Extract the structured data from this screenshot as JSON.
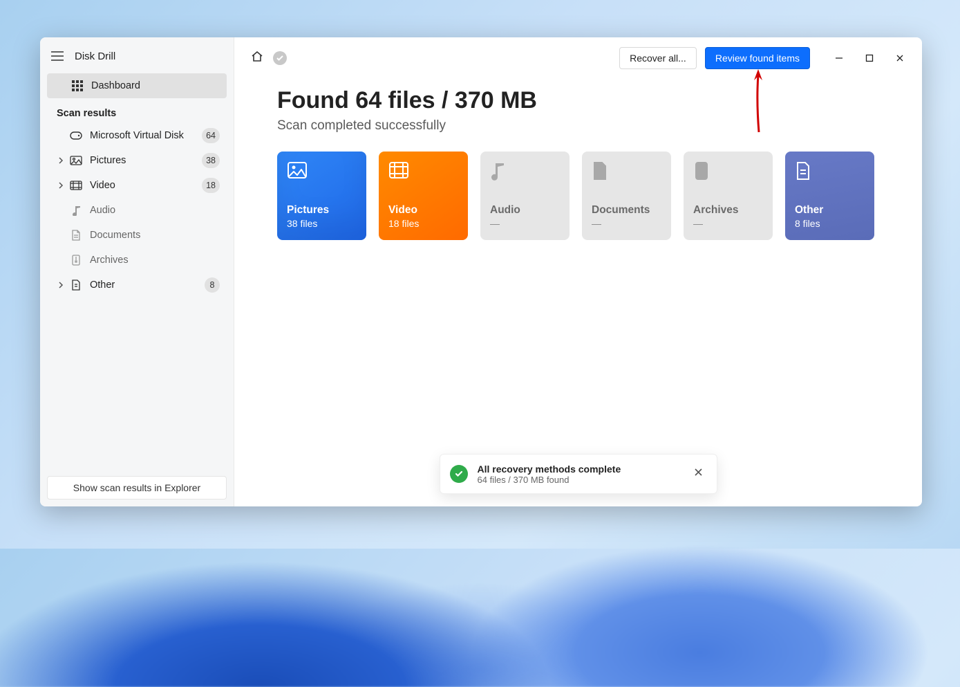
{
  "app": {
    "title": "Disk Drill"
  },
  "sidebar": {
    "dashboard": "Dashboard",
    "section": "Scan results",
    "items": [
      {
        "label": "Microsoft Virtual Disk",
        "count": "64",
        "expandable": false
      },
      {
        "label": "Pictures",
        "count": "38",
        "expandable": true
      },
      {
        "label": "Video",
        "count": "18",
        "expandable": true
      },
      {
        "label": "Audio",
        "count": "",
        "expandable": false
      },
      {
        "label": "Documents",
        "count": "",
        "expandable": false
      },
      {
        "label": "Archives",
        "count": "",
        "expandable": false
      },
      {
        "label": "Other",
        "count": "8",
        "expandable": true
      }
    ],
    "footer_button": "Show scan results in Explorer"
  },
  "topbar": {
    "recover": "Recover all...",
    "review": "Review found items"
  },
  "headline": {
    "title": "Found 64 files / 370 MB",
    "subtitle": "Scan completed successfully"
  },
  "cards": [
    {
      "title": "Pictures",
      "sub": "38 files"
    },
    {
      "title": "Video",
      "sub": "18 files"
    },
    {
      "title": "Audio",
      "sub": "—"
    },
    {
      "title": "Documents",
      "sub": "—"
    },
    {
      "title": "Archives",
      "sub": "—"
    },
    {
      "title": "Other",
      "sub": "8 files"
    }
  ],
  "toast": {
    "title": "All recovery methods complete",
    "subtitle": "64 files / 370 MB found"
  }
}
